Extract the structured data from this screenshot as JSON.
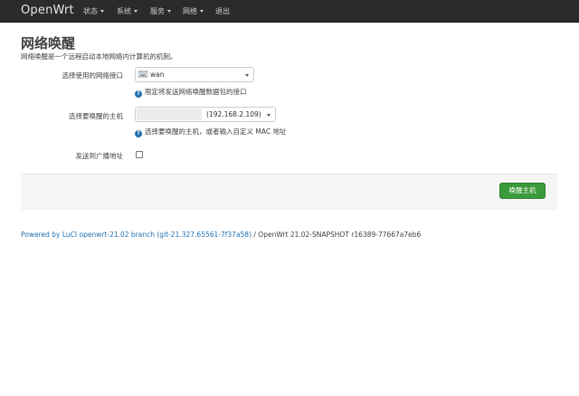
{
  "navbar": {
    "brand": "OpenWrt",
    "menu": [
      {
        "label": "状态",
        "has_dropdown": true
      },
      {
        "label": "系统",
        "has_dropdown": true
      },
      {
        "label": "服务",
        "has_dropdown": true
      },
      {
        "label": "网络",
        "has_dropdown": true
      },
      {
        "label": "退出",
        "has_dropdown": false
      }
    ]
  },
  "page": {
    "title": "网络唤醒",
    "description": "网络唤醒是一个远程启动本地网络内计算机的机制。"
  },
  "form": {
    "interface": {
      "label": "选择使用的网络接口",
      "value": "wan",
      "hint": "限定将发送网络唤醒数据包的接口",
      "icon": "network-port-icon"
    },
    "host": {
      "label": "选择要唤醒的主机",
      "value": "(192.168.2.109)",
      "hint": "选择要唤醒的主机，或者输入自定义 MAC 地址"
    },
    "broadcast": {
      "label": "发送到广播地址",
      "checked": false
    }
  },
  "actions": {
    "wake_label": "唤醒主机",
    "wake_color": "#3b9a3b"
  },
  "footer": {
    "link_text": "Powered by LuCI openwrt-21.02 branch (git-21.327.65561-7f37a58)",
    "rest_text": " / OpenWrt 21.02-SNAPSHOT r16389-77667a7eb6"
  },
  "colors": {
    "navbar_bg": "#2b2b2b",
    "link": "#1f6fb0",
    "help_icon": "#1f6fb0"
  }
}
